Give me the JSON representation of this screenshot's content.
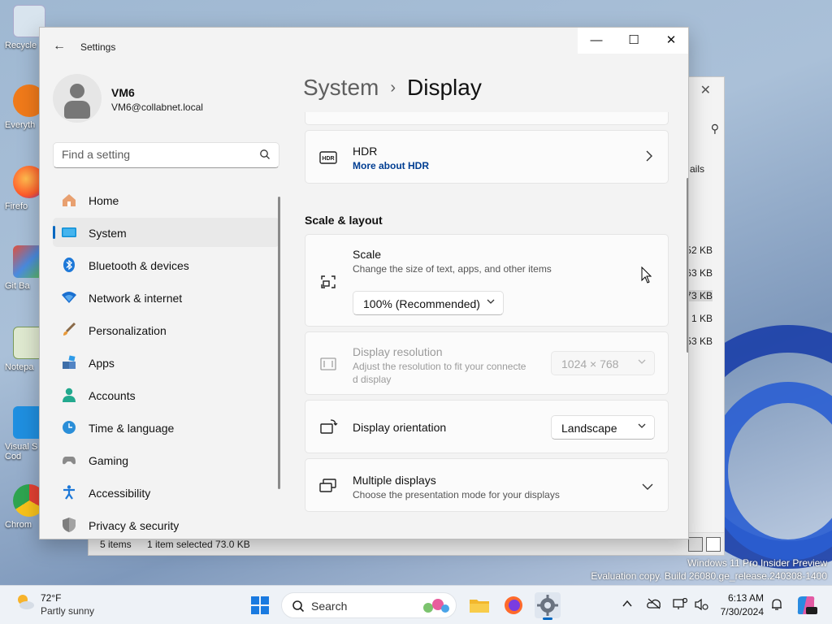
{
  "desktop": {
    "icons": [
      "Recycle",
      "Everyth",
      "Firefo",
      "Git Ba",
      "Notepa",
      "Visual S Cod",
      "Chrom"
    ],
    "watermark_line1": "Windows 11 Pro Insider Preview",
    "watermark_line2": "Evaluation copy. Build 26080.ge_release.240308-1400"
  },
  "explorer": {
    "details_label": "ails",
    "sizes": [
      "52 KB",
      "63 KB",
      "73 KB",
      "1 KB",
      "53 KB"
    ],
    "status_items": "5 items",
    "status_selected": "1 item selected  73.0 KB"
  },
  "settings": {
    "app_title": "Settings",
    "window_controls": {
      "minimize": "—",
      "maximize": "☐",
      "close": "✕"
    },
    "profile": {
      "name": "VM6",
      "email": "VM6@collabnet.local"
    },
    "search": {
      "placeholder": "Find a setting"
    },
    "nav": [
      {
        "label": "Home",
        "icon": "home-icon",
        "active": false
      },
      {
        "label": "System",
        "icon": "system-icon",
        "active": true
      },
      {
        "label": "Bluetooth & devices",
        "icon": "bluetooth-icon",
        "active": false
      },
      {
        "label": "Network & internet",
        "icon": "network-icon",
        "active": false
      },
      {
        "label": "Personalization",
        "icon": "brush-icon",
        "active": false
      },
      {
        "label": "Apps",
        "icon": "apps-icon",
        "active": false
      },
      {
        "label": "Accounts",
        "icon": "accounts-icon",
        "active": false
      },
      {
        "label": "Time & language",
        "icon": "globe-clock-icon",
        "active": false
      },
      {
        "label": "Gaming",
        "icon": "gamepad-icon",
        "active": false
      },
      {
        "label": "Accessibility",
        "icon": "accessibility-icon",
        "active": false
      },
      {
        "label": "Privacy & security",
        "icon": "shield-icon",
        "active": false
      }
    ],
    "breadcrumb": {
      "parent": "System",
      "separator": "›",
      "current": "Display"
    },
    "hdr": {
      "title": "HDR",
      "link": "More about HDR"
    },
    "section_title": "Scale & layout",
    "scale": {
      "title": "Scale",
      "subtitle": "Change the size of text, apps, and other items",
      "value": "100% (Recommended)"
    },
    "resolution": {
      "title": "Display resolution",
      "subtitle_line1": "Adjust the resolution to fit your connecte",
      "subtitle_line2": "d display",
      "value": "1024 × 768"
    },
    "orientation": {
      "title": "Display orientation",
      "value": "Landscape"
    },
    "multiple": {
      "title": "Multiple displays",
      "subtitle": "Choose the presentation mode for your displays"
    }
  },
  "taskbar": {
    "weather_temp": "72°F",
    "weather_desc": "Partly sunny",
    "search_label": "Search",
    "time": "6:13 AM",
    "date": "7/30/2024"
  },
  "colors": {
    "accent": "#0067c0",
    "link": "#003e92"
  }
}
